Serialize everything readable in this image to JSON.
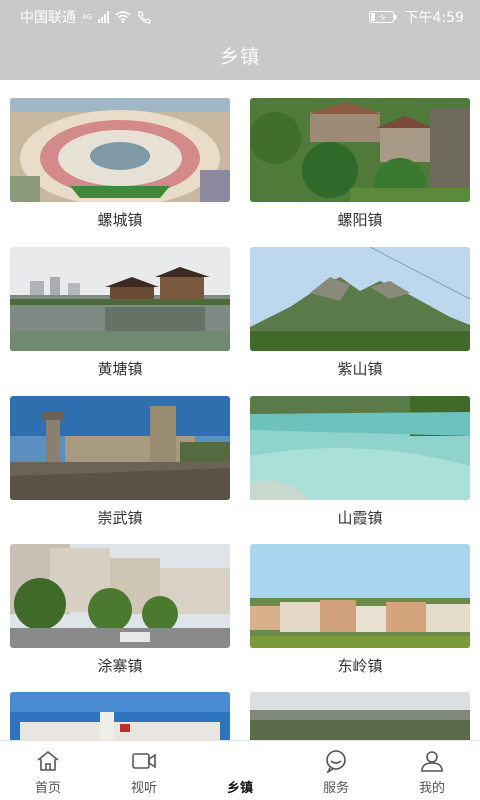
{
  "status_bar": {
    "carrier": "中国联通",
    "network": "4G",
    "time": "下午4:59"
  },
  "header": {
    "title": "乡镇"
  },
  "towns": [
    {
      "name": "螺城镇",
      "scene": "plaza"
    },
    {
      "name": "螺阳镇",
      "scene": "village"
    },
    {
      "name": "黄塘镇",
      "scene": "lake"
    },
    {
      "name": "紫山镇",
      "scene": "mountain"
    },
    {
      "name": "崇武镇",
      "scene": "fort"
    },
    {
      "name": "山霞镇",
      "scene": "river"
    },
    {
      "name": "涂寨镇",
      "scene": "street"
    },
    {
      "name": "东岭镇",
      "scene": "houses"
    },
    {
      "name": "",
      "scene": "building"
    },
    {
      "name": "",
      "scene": "aerial"
    }
  ],
  "tabbar": {
    "active": "乡镇",
    "items": [
      {
        "label": "首页",
        "icon": "home-icon"
      },
      {
        "label": "视听",
        "icon": "video-icon"
      },
      {
        "label": "乡镇",
        "icon": "town-icon"
      },
      {
        "label": "服务",
        "icon": "chat-icon"
      },
      {
        "label": "我的",
        "icon": "user-icon"
      }
    ]
  }
}
